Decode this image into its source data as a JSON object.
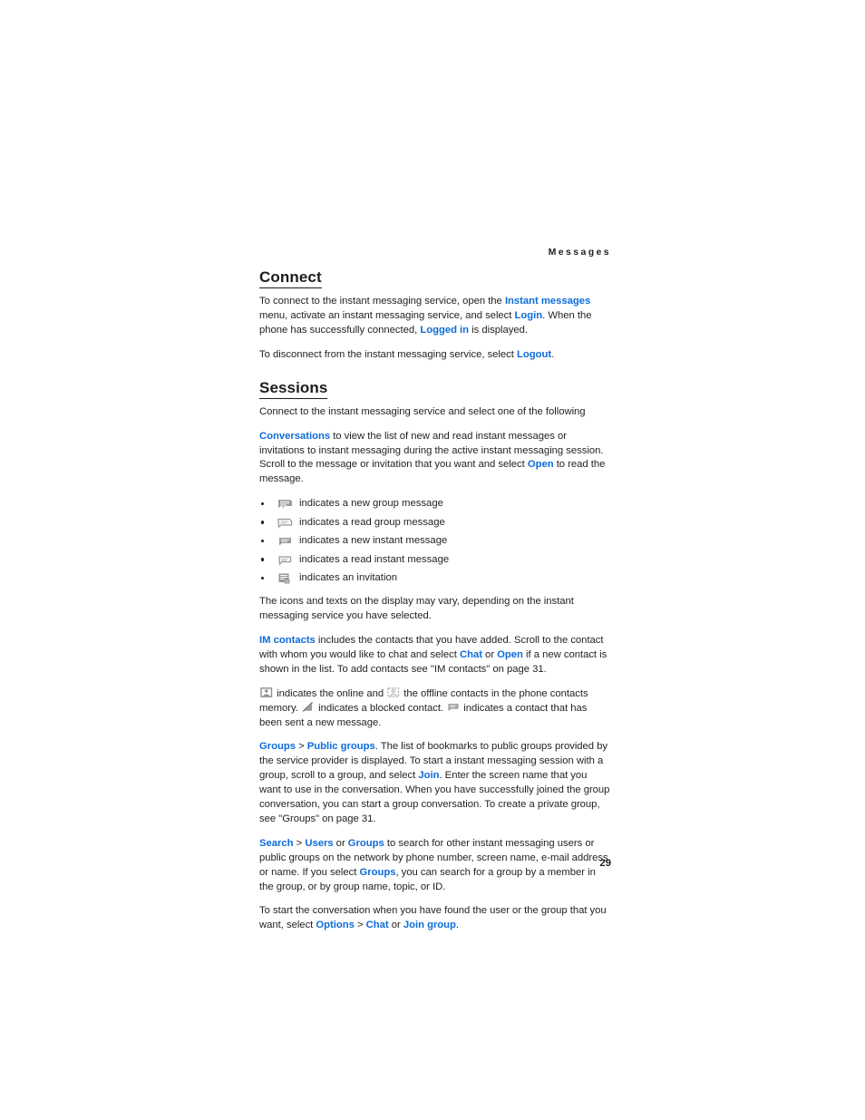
{
  "page": {
    "running_head": "Messages",
    "folio": "29",
    "link_color": "#0d6cd9",
    "text_color": "#231f20"
  },
  "sections": [
    {
      "id": "connect",
      "heading": "Connect",
      "paragraphs": [
        {
          "id": "connect-p1",
          "runs": [
            {
              "t": "To connect to the instant messaging service, open the ",
              "k": "plain"
            },
            {
              "t": "Instant messages",
              "k": "link"
            },
            {
              "t": " menu, activate an instant messaging service, and select ",
              "k": "plain"
            },
            {
              "t": "Login",
              "k": "link"
            },
            {
              "t": ". When the phone has successfully connected, ",
              "k": "plain"
            },
            {
              "t": "Logged in",
              "k": "link"
            },
            {
              "t": " is displayed.",
              "k": "plain"
            }
          ]
        },
        {
          "id": "connect-p2",
          "runs": [
            {
              "t": "To disconnect from the instant messaging service, select ",
              "k": "plain"
            },
            {
              "t": "Logout",
              "k": "link"
            },
            {
              "t": ".",
              "k": "plain"
            }
          ]
        }
      ]
    },
    {
      "id": "sessions",
      "heading": "Sessions",
      "paragraphs": [
        {
          "id": "sessions-p1",
          "runs": [
            {
              "t": "Connect to the instant messaging service and select one of the following",
              "k": "plain"
            }
          ]
        },
        {
          "id": "sessions-p2",
          "runs": [
            {
              "t": "Conversations",
              "k": "link"
            },
            {
              "t": " to view the list of new and read instant messages or invitations to instant messaging during the active instant messaging session. Scroll to the message or invitation that you want and select ",
              "k": "plain"
            },
            {
              "t": "Open",
              "k": "link"
            },
            {
              "t": " to read the message.",
              "k": "plain"
            }
          ]
        }
      ]
    }
  ],
  "bullet_list": {
    "items": [
      {
        "icon": "new-group-message-icon",
        "label": "indicates a new group message"
      },
      {
        "icon": "read-group-message-icon",
        "label": "indicates a read group message"
      },
      {
        "icon": "new-instant-message-icon",
        "label": "indicates a new instant message"
      },
      {
        "icon": "read-instant-message-icon",
        "label": "indicates a read instant message"
      },
      {
        "icon": "invitation-icon",
        "label": "indicates an invitation"
      }
    ]
  },
  "after_bullets": {
    "id": "icons-note",
    "runs": [
      {
        "t": "The icons and texts on the display may vary, depending on the instant messaging service you have selected.",
        "k": "plain"
      }
    ]
  },
  "im_contacts": {
    "id": "im-contacts-p",
    "runs": [
      {
        "t": "IM contacts",
        "k": "link"
      },
      {
        "t": " includes the contacts that you have added. Scroll to the contact with whom you would like to chat and select ",
        "k": "plain"
      },
      {
        "t": "Chat",
        "k": "link"
      },
      {
        "t": " or ",
        "k": "plain"
      },
      {
        "t": "Open",
        "k": "link"
      },
      {
        "t": " if a new contact is shown in the list. To add contacts see \"IM contacts\" on page 31.",
        "k": "plain"
      }
    ]
  },
  "status_icons_para": {
    "id": "status-icons-p",
    "segments": [
      {
        "k": "icon",
        "icon": "online-contact-icon"
      },
      {
        "k": "plain",
        "t": " indicates the online and "
      },
      {
        "k": "icon",
        "icon": "offline-contact-icon"
      },
      {
        "k": "plain",
        "t": " the offline contacts in the phone contacts memory. "
      },
      {
        "k": "icon",
        "icon": "blocked-contact-icon"
      },
      {
        "k": "plain",
        "t": " indicates a blocked contact. "
      },
      {
        "k": "icon",
        "icon": "sent-new-message-icon"
      },
      {
        "k": "plain",
        "t": " indicates a contact that has been sent a new message."
      }
    ]
  },
  "groups_para": {
    "id": "groups-p",
    "runs": [
      {
        "t": "Groups",
        "k": "link"
      },
      {
        "t": " > ",
        "k": "plain"
      },
      {
        "t": "Public groups",
        "k": "link"
      },
      {
        "t": ". The list of bookmarks to public groups provided by the service provider is displayed. To start a instant messaging session with a group, scroll to a group, and select ",
        "k": "plain"
      },
      {
        "t": "Join",
        "k": "link"
      },
      {
        "t": ". Enter the screen name that you want to use in the conversation. When you have successfully joined the group conversation, you can start a group conversation. To create a private group, see \"Groups\" on page 31.",
        "k": "plain"
      }
    ]
  },
  "search_para": {
    "id": "search-p",
    "runs": [
      {
        "t": "Search",
        "k": "link"
      },
      {
        "t": " > ",
        "k": "plain"
      },
      {
        "t": "Users",
        "k": "link"
      },
      {
        "t": " or ",
        "k": "plain"
      },
      {
        "t": "Groups",
        "k": "link"
      },
      {
        "t": " to search for other instant messaging users or public groups on the network by phone number, screen name, e-mail address, or name. If you select ",
        "k": "plain"
      },
      {
        "t": "Groups",
        "k": "link"
      },
      {
        "t": ", you can search for a group by a member in the group, or by group name, topic, or ID.",
        "k": "plain"
      }
    ]
  },
  "start_conversation_para": {
    "id": "start-conversation-p",
    "runs": [
      {
        "t": "To start the conversation when you have found the user or the group that you want, select ",
        "k": "plain"
      },
      {
        "t": "Options",
        "k": "link"
      },
      {
        "t": " > ",
        "k": "plain"
      },
      {
        "t": "Chat",
        "k": "link"
      },
      {
        "t": " or ",
        "k": "plain"
      },
      {
        "t": "Join group",
        "k": "link"
      },
      {
        "t": ".",
        "k": "plain"
      }
    ]
  }
}
